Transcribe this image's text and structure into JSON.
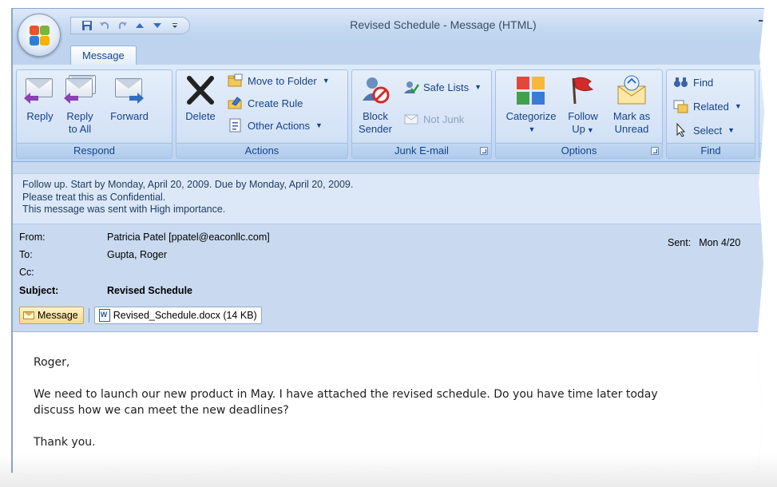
{
  "window": {
    "title": "Revised Schedule - Message (HTML)"
  },
  "quick_access": {
    "items": [
      "save-icon",
      "undo-icon",
      "redo-icon",
      "up-icon",
      "down-icon",
      "more-icon"
    ]
  },
  "tabs": [
    {
      "label": "Message",
      "selected": true
    }
  ],
  "ribbon": {
    "respond": {
      "label": "Respond",
      "reply": "Reply",
      "reply_all_1": "Reply",
      "reply_all_2": "to All",
      "forward": "Forward"
    },
    "actions": {
      "label": "Actions",
      "delete": "Delete",
      "move_to_folder": "Move to Folder",
      "create_rule": "Create Rule",
      "other_actions": "Other Actions"
    },
    "junk": {
      "label": "Junk E-mail",
      "block_sender_1": "Block",
      "block_sender_2": "Sender",
      "safe_lists": "Safe Lists",
      "not_junk": "Not Junk"
    },
    "options": {
      "label": "Options",
      "categorize": "Categorize",
      "follow_up_1": "Follow",
      "follow_up_2": "Up",
      "mark_unread_1": "Mark as",
      "mark_unread_2": "Unread"
    },
    "find": {
      "label": "Find",
      "find": "Find",
      "related": "Related",
      "select": "Select"
    }
  },
  "infobar": {
    "line1": "Follow up.  Start by Monday, April 20, 2009.  Due by Monday, April 20, 2009.",
    "line2": "Please treat this as Confidential.",
    "line3": "This message was sent with High importance."
  },
  "headers": {
    "from_label": "From:",
    "from_value": "Patricia Patel [ppatel@eaconllc.com]",
    "to_label": "To:",
    "to_value": "Gupta, Roger",
    "cc_label": "Cc:",
    "cc_value": "",
    "subject_label": "Subject:",
    "subject_value": "Revised Schedule",
    "sent_label": "Sent:",
    "sent_value": "Mon 4/20"
  },
  "attachments": {
    "message_tab": "Message",
    "file": "Revised_Schedule.docx (14 KB)"
  },
  "body": {
    "greeting": "Roger,",
    "line1": "We need to launch our new product in May. I have attached the revised schedule. Do you have time later today",
    "line2": "discuss how we can meet the new deadlines?",
    "closing": "Thank you."
  },
  "colors": {
    "ribbon_text": "#15428b",
    "window_bg": "#c9daf0",
    "flag_red": "#d42a2a"
  }
}
